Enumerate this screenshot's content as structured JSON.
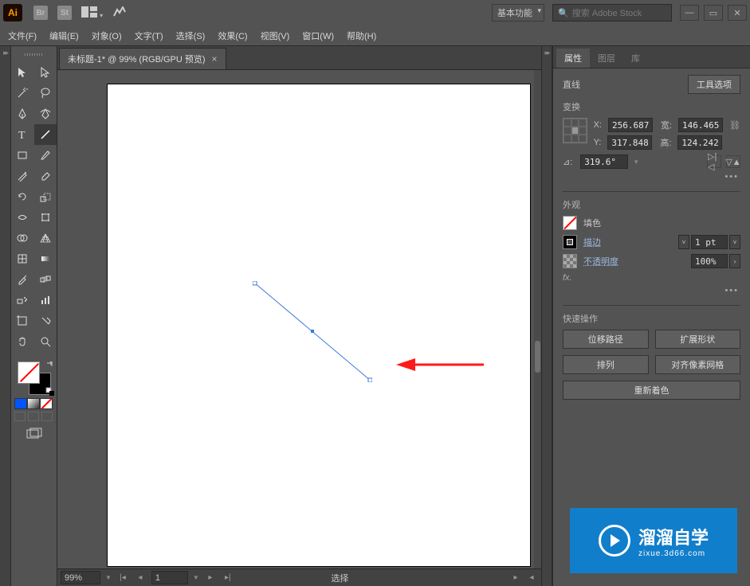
{
  "titlebar": {
    "bridge": "Br",
    "stock": "St",
    "workspace": "基本功能",
    "search_placeholder": "搜索 Adobe Stock"
  },
  "menu": [
    "文件(F)",
    "编辑(E)",
    "对象(O)",
    "文字(T)",
    "选择(S)",
    "效果(C)",
    "视图(V)",
    "窗口(W)",
    "帮助(H)"
  ],
  "tab": {
    "title": "未标题-1* @ 99% (RGB/GPU 预览)"
  },
  "status": {
    "zoom": "99%",
    "artboard": "1",
    "mode": "选择"
  },
  "panels": {
    "tabs": [
      "属性",
      "图层",
      "库"
    ],
    "object_type": "直线",
    "tool_options_btn": "工具选项",
    "sections": {
      "transform": "变换",
      "appearance": "外观",
      "quick": "快速操作"
    },
    "transform": {
      "labels": {
        "x": "X:",
        "y": "Y:",
        "w": "宽:",
        "h": "高:",
        "angle": "⊿:"
      },
      "x": "256.687",
      "y": "317.848",
      "w": "146.465",
      "h": "124.242",
      "angle": "319.6°"
    },
    "appearance": {
      "fill": "填色",
      "stroke": "描边",
      "stroke_val": "1 pt",
      "opacity": "不透明度",
      "opacity_val": "100%",
      "fx": "fx."
    },
    "quick": {
      "offset": "位移路径",
      "expand": "扩展形状",
      "arrange": "排列",
      "align": "对齐像素网格",
      "recolor": "重新着色"
    }
  },
  "watermark": {
    "big": "溜溜自学",
    "small": "zixue.3d66.com"
  }
}
